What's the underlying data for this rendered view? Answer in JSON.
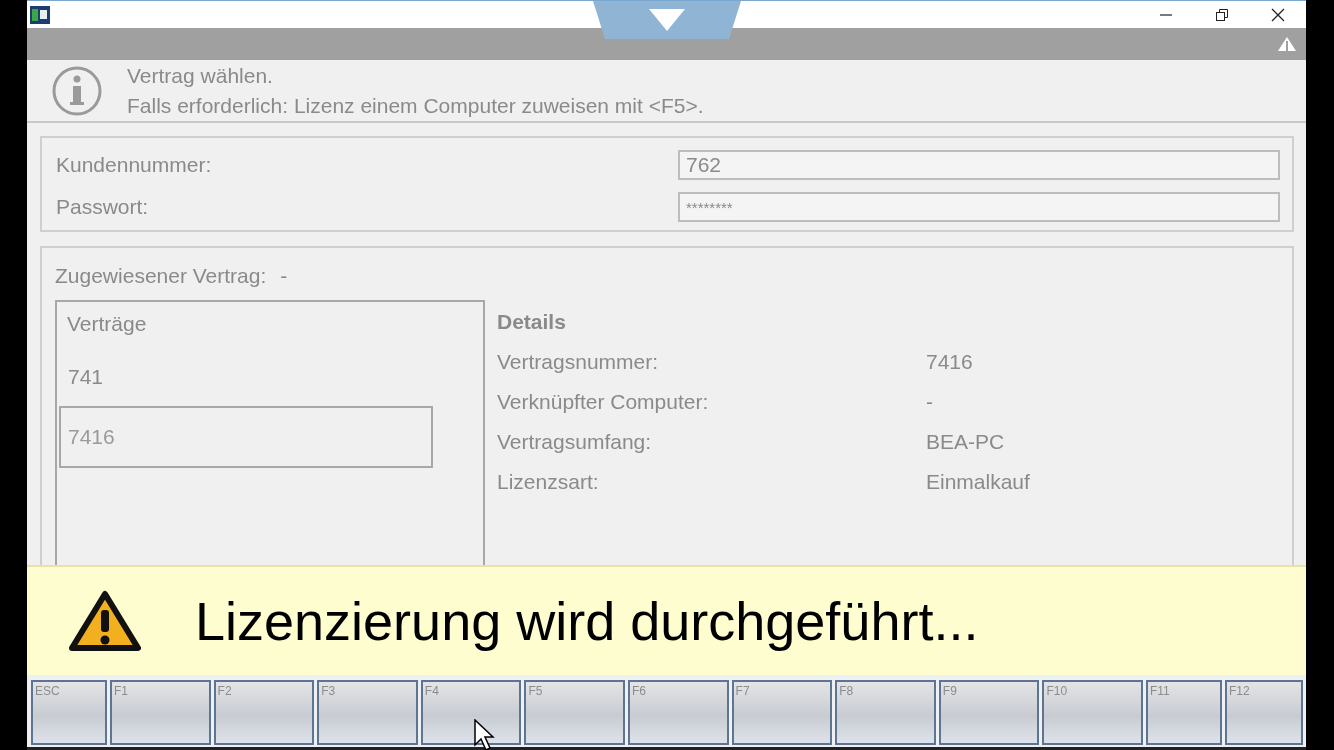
{
  "info": {
    "lines": [
      "Vertrag wählen.",
      "Falls erforderlich: Lizenz einem Computer zuweisen mit <F5>."
    ]
  },
  "credentials": [
    {
      "label": "Kundennummer:",
      "value": "762"
    },
    {
      "label": "Passwort:",
      "value": "********"
    }
  ],
  "assigned": {
    "label": "Zugewiesener Vertrag:",
    "value": "-"
  },
  "contracts": {
    "title": "Verträge",
    "items": [
      {
        "number": "741",
        "selected": false
      },
      {
        "number": "7416",
        "selected": true
      }
    ]
  },
  "details": {
    "title": "Details",
    "rows": [
      {
        "label": "Vertragsnummer:",
        "value": "7416"
      },
      {
        "label": "Verknüpfter Computer:",
        "value": "-"
      },
      {
        "label": "Vertragsumfang:",
        "value": "BEA-PC"
      },
      {
        "label": "Lizenzsart:",
        "value": "Einmalkauf"
      }
    ]
  },
  "banner": {
    "text": "Lizenzierung wird durchgeführt..."
  },
  "function_keys": [
    "ESC",
    "F1",
    "F2",
    "F3",
    "F4",
    "F5",
    "F6",
    "F7",
    "F8",
    "F9",
    "F10",
    "F11",
    "F12"
  ]
}
